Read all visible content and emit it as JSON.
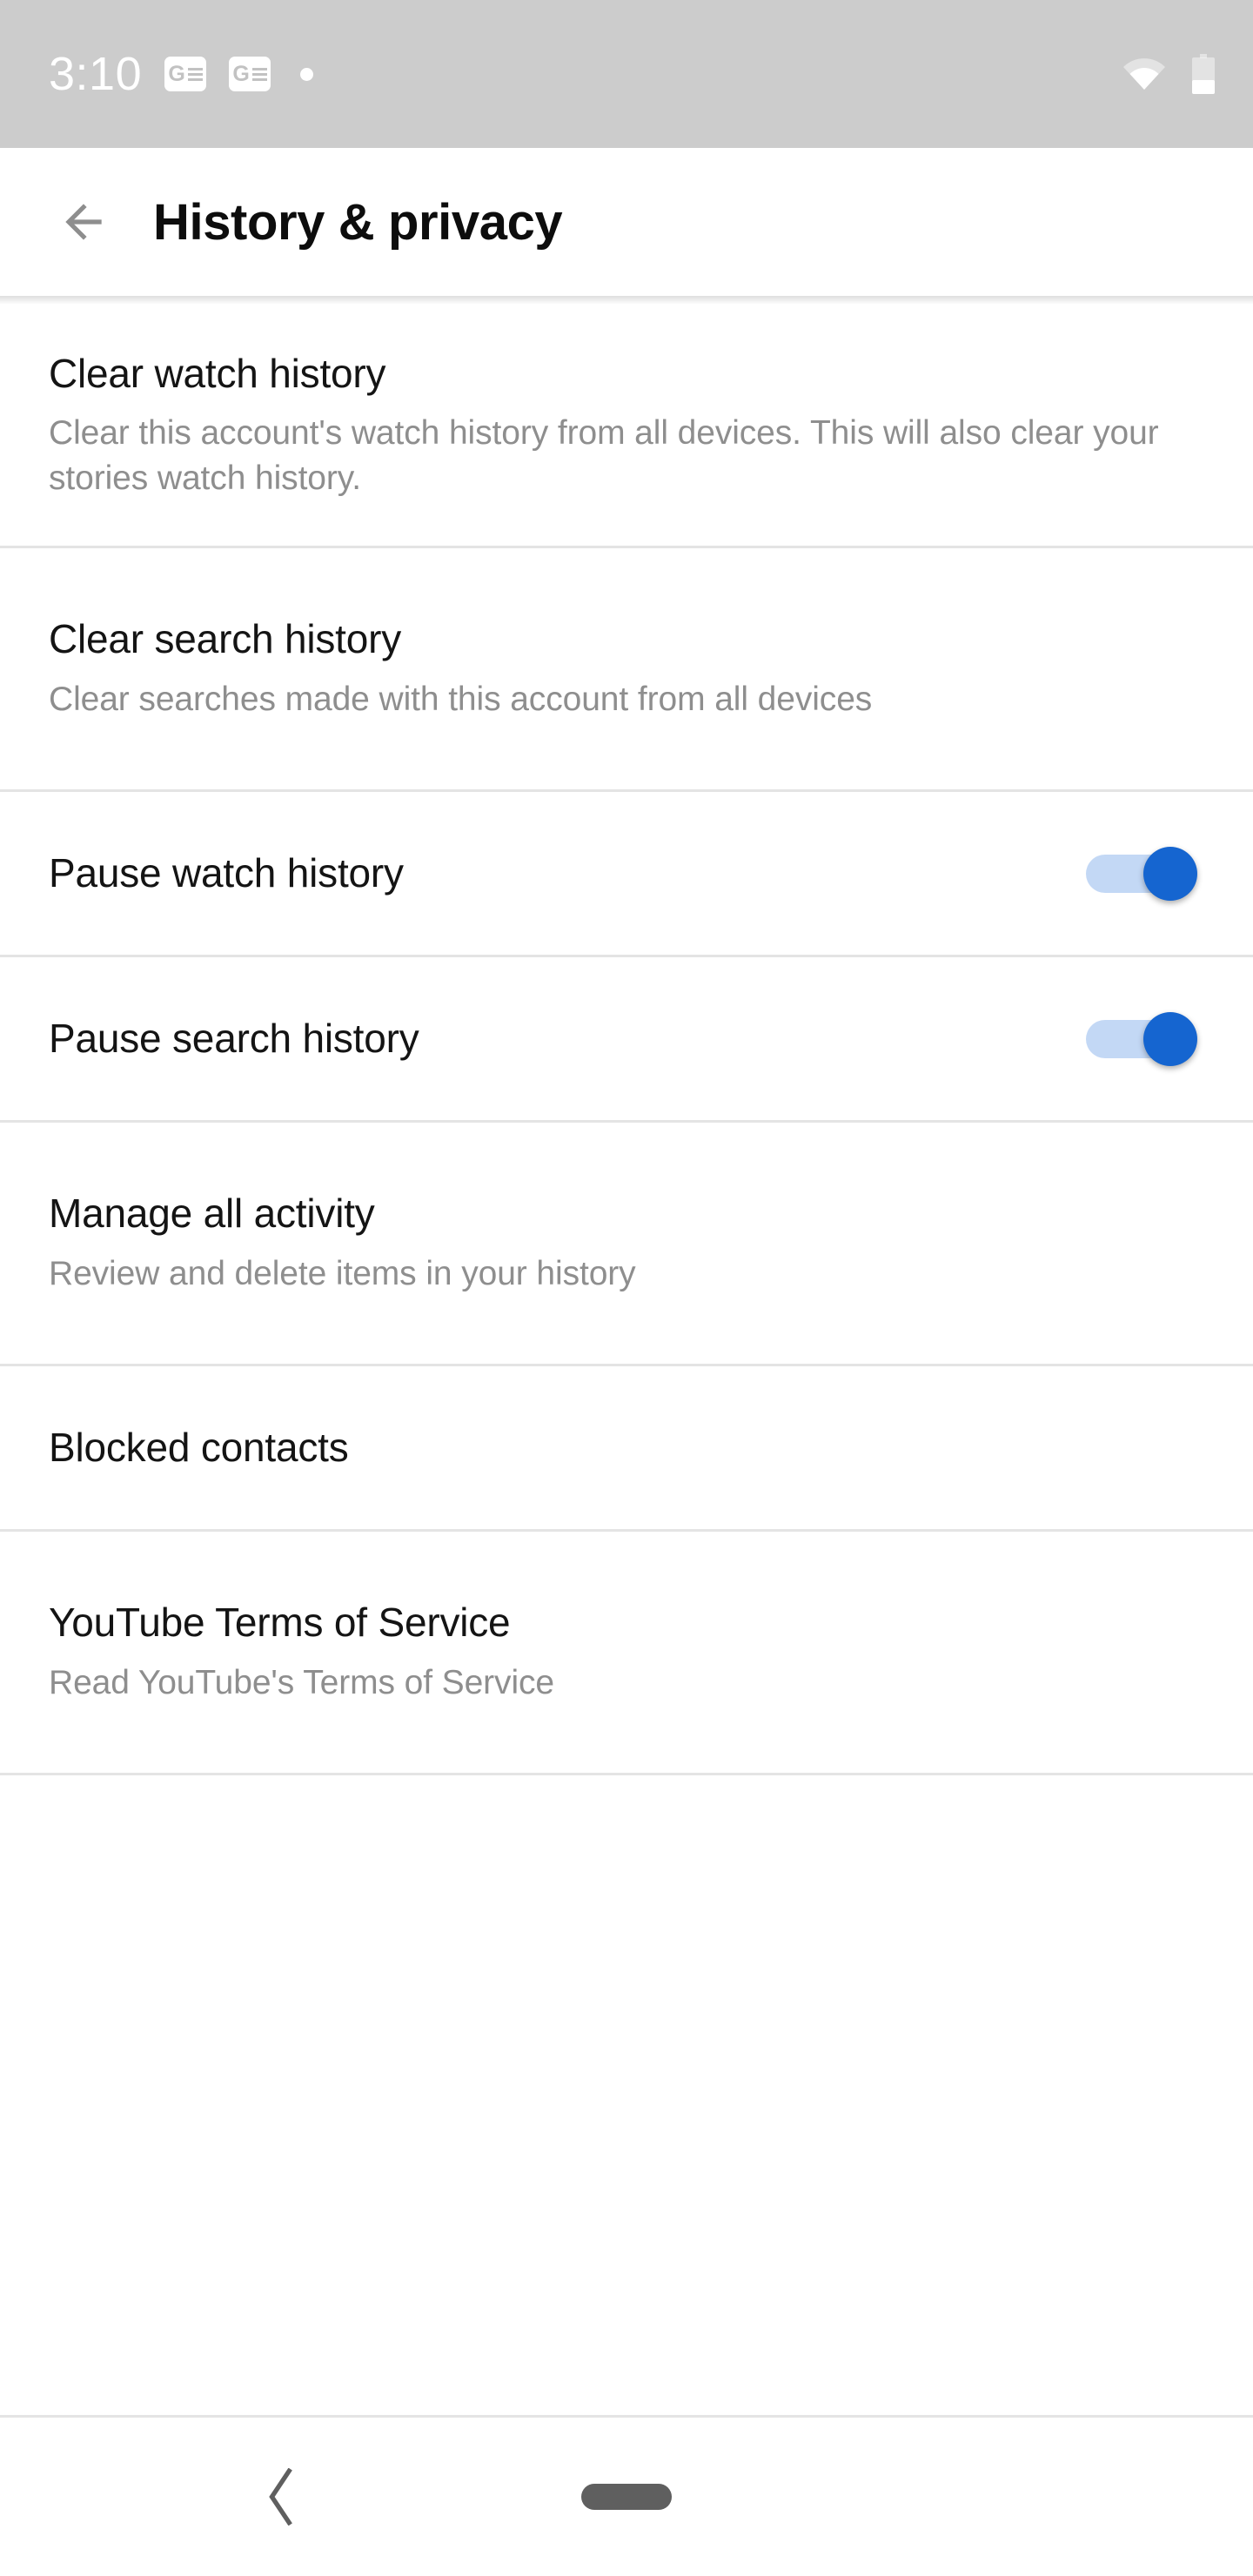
{
  "status_bar": {
    "time": "3:10",
    "icons": [
      "google-news-icon",
      "google-news-icon",
      "notification-dot-icon"
    ],
    "wifi_icon": "wifi-icon",
    "battery_icon": "battery-low-icon",
    "background_color": "#cccccc",
    "foreground_color": "#ffffff"
  },
  "app_bar": {
    "back_icon": "arrow-back-icon",
    "title": "History & privacy"
  },
  "settings": {
    "items": [
      {
        "id": "clear-watch-history",
        "title": "Clear watch history",
        "subtitle": "Clear this account's watch history from all devices. This will also clear your stories watch history.",
        "type": "action"
      },
      {
        "id": "clear-search-history",
        "title": "Clear search history",
        "subtitle": "Clear searches made with this account from all devices",
        "type": "action"
      },
      {
        "id": "pause-watch-history",
        "title": "Pause watch history",
        "subtitle": "",
        "type": "toggle",
        "value": "on"
      },
      {
        "id": "pause-search-history",
        "title": "Pause search history",
        "subtitle": "",
        "type": "toggle",
        "value": "on"
      },
      {
        "id": "manage-all-activity",
        "title": "Manage all activity",
        "subtitle": "Review and delete items in your history",
        "type": "action"
      },
      {
        "id": "blocked-contacts",
        "title": "Blocked contacts",
        "subtitle": "",
        "type": "action"
      },
      {
        "id": "youtube-terms-of-service",
        "title": "YouTube Terms of Service",
        "subtitle": "Read YouTube's Terms of Service",
        "type": "action"
      }
    ]
  },
  "nav_bar": {
    "back_icon": "chevron-back-icon",
    "home_icon": "home-pill-icon"
  },
  "colors": {
    "toggle_on_thumb": "#1565d0",
    "toggle_on_track": "#c3d8f5",
    "divider": "#e4e4e4",
    "title_text": "#141414",
    "subtitle_text": "#8e8e8e",
    "status_bar_bg": "#cccccc"
  }
}
